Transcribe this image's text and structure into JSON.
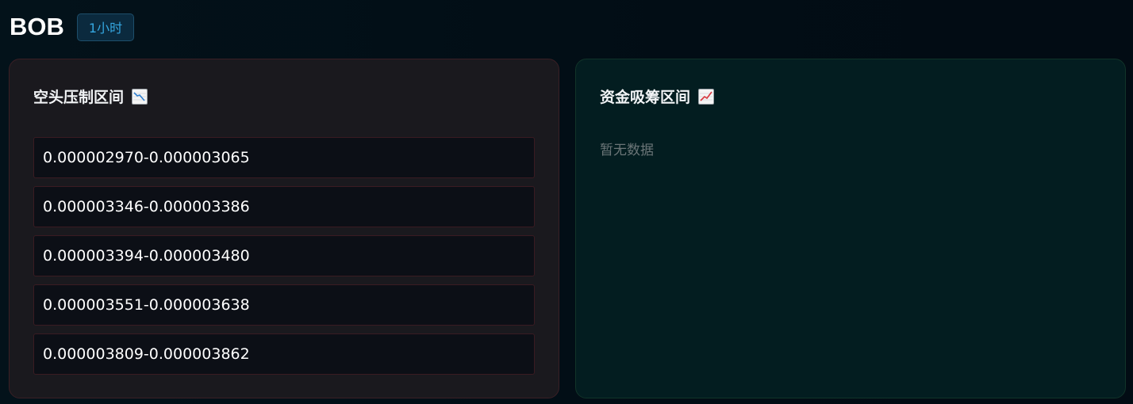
{
  "header": {
    "symbol": "BOB",
    "timeframe": "1小时"
  },
  "resistance": {
    "title": "空头压制区间",
    "icon": "chart-decreasing-icon",
    "zones": [
      "0.000002970-0.000003065",
      "0.000003346-0.000003386",
      "0.000003394-0.000003480",
      "0.000003551-0.000003638",
      "0.000003809-0.000003862"
    ]
  },
  "support": {
    "title": "资金吸筹区间",
    "icon": "chart-increasing-icon",
    "empty_text": "暂无数据"
  },
  "colors": {
    "resistance_border": "#3a1b22",
    "support_border": "#113429",
    "accent": "#35a7e0",
    "chart_line": "#d9363e"
  }
}
